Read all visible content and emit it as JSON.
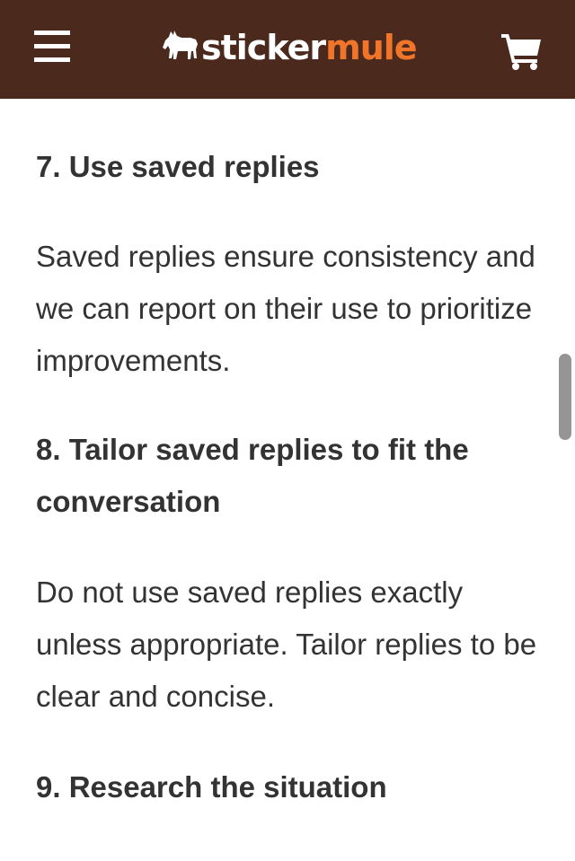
{
  "header": {
    "logo": {
      "part1": "sticker",
      "part2": "mule",
      "icon": "mule-icon",
      "colors": {
        "part1": "#ffffff",
        "part2": "#f0752b"
      }
    },
    "menu_icon": "hamburger-menu-icon",
    "cart_icon": "shopping-cart-icon",
    "background": "#4b2a1d"
  },
  "article": {
    "sections": [
      {
        "heading": "7. Use saved replies",
        "body": "Saved replies ensure consistency and we can report on their use to prioritize improvements."
      },
      {
        "heading": "8. Tailor saved replies to fit the conversation",
        "body": "Do not use saved replies exactly unless appropriate. Tailor replies to be clear and concise."
      },
      {
        "heading": "9. Research the situation"
      }
    ]
  }
}
